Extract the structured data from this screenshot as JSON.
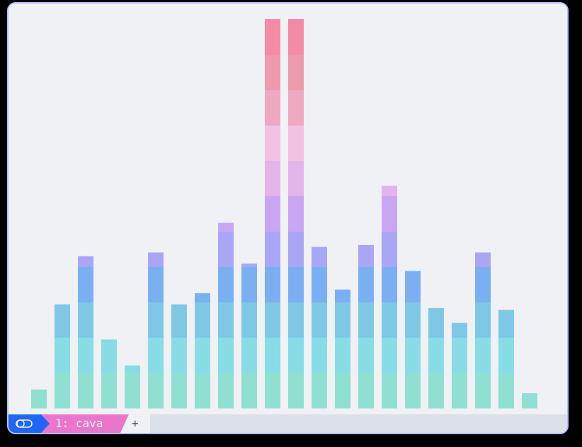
{
  "tabs": {
    "active_label": "1: cava",
    "new_tab_label": "+"
  },
  "icons": {
    "session": "toggle-switch-icon"
  },
  "colors": {
    "window_background": "#eff1f5",
    "window_border": "#b7bdf8",
    "statusbar_background": "#dce0e8",
    "session_accent": "#1e66f5",
    "active_tab": "#ea76cb",
    "gradient": [
      "#8fe0d0",
      "#87dce6",
      "#7ec8e6",
      "#7ab0f2",
      "#a9a6f6",
      "#c9a6f2",
      "#e2b4ea",
      "#f2c2e4",
      "#eea8c0",
      "#ec9aac",
      "#f28ba4"
    ]
  },
  "visualizer": {
    "max_level": 21,
    "bar_levels": [
      1,
      5.6,
      8.2,
      3.7,
      2.3,
      8.4,
      5.6,
      6.2,
      10,
      7.8,
      21,
      21,
      8.7,
      6.4,
      8.8,
      12,
      7.4,
      5.4,
      4.6,
      8.4,
      5.3,
      0.8
    ]
  }
}
